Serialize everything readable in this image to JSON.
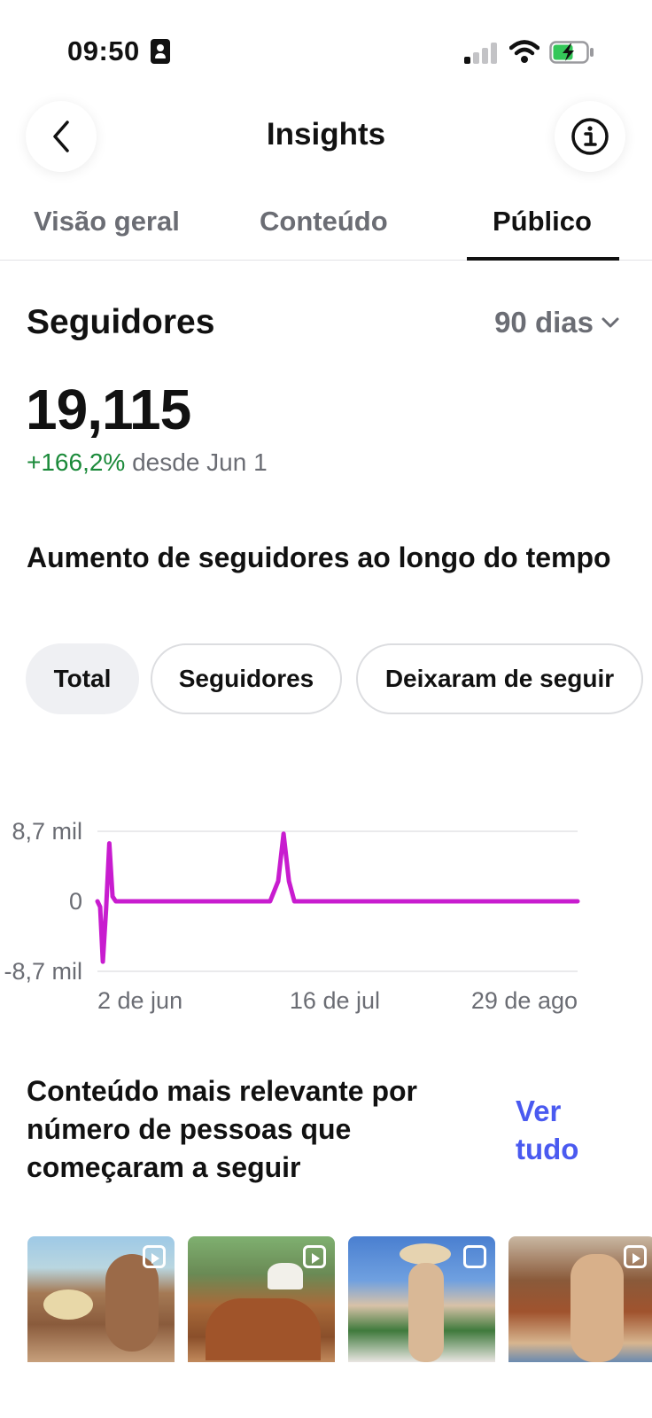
{
  "status_bar": {
    "time": "09:50"
  },
  "header": {
    "title": "Insights"
  },
  "tabs": [
    {
      "label": "Visão geral",
      "active": false
    },
    {
      "label": "Conteúdo",
      "active": false
    },
    {
      "label": "Público",
      "active": true
    }
  ],
  "followers": {
    "title": "Seguidores",
    "range": "90 dias",
    "count": "19,115",
    "change_pct": "+166,2%",
    "change_since": "desde Jun 1"
  },
  "growth_section": {
    "title": "Aumento de seguidores ao longo do tempo",
    "chips": [
      {
        "label": "Total",
        "selected": true
      },
      {
        "label": "Seguidores",
        "selected": false
      },
      {
        "label": "Deixaram de seguir",
        "selected": false
      }
    ]
  },
  "chart_data": {
    "type": "line",
    "y_tick_labels": [
      "8,7 mil",
      "0",
      "-8,7 mil"
    ],
    "y_ticks": [
      8700,
      0,
      -8700
    ],
    "ylim": [
      -8700,
      8700
    ],
    "x_tick_labels": [
      "2 de jun",
      "16 de jul",
      "29 de ago"
    ],
    "x_ticks": [
      0,
      44,
      88
    ],
    "xlim": [
      0,
      89
    ],
    "line_color": "#c81ccf",
    "series": [
      {
        "x": [
          0,
          0.5,
          1,
          1.6,
          2.2,
          2.8,
          3.4,
          4,
          8,
          14,
          20,
          26,
          30,
          32,
          33.5,
          34.5,
          35.5,
          36.5,
          38,
          42,
          46,
          50,
          58,
          66,
          74,
          82,
          89
        ],
        "values": [
          0,
          -700,
          -7500,
          -1000,
          7200,
          600,
          0,
          0,
          0,
          0,
          0,
          0,
          0,
          0,
          2500,
          8400,
          2500,
          0,
          0,
          0,
          0,
          0,
          0,
          0,
          0,
          0,
          0
        ]
      }
    ]
  },
  "top_content": {
    "title": "Conteúdo mais relevante por número de pessoas que começaram a seguir",
    "see_all": "Ver tudo",
    "thumbnails": [
      {
        "type_icon": "reel-icon"
      },
      {
        "type_icon": "reel-icon"
      },
      {
        "type_icon": "carousel-icon"
      },
      {
        "type_icon": "reel-icon"
      }
    ]
  }
}
